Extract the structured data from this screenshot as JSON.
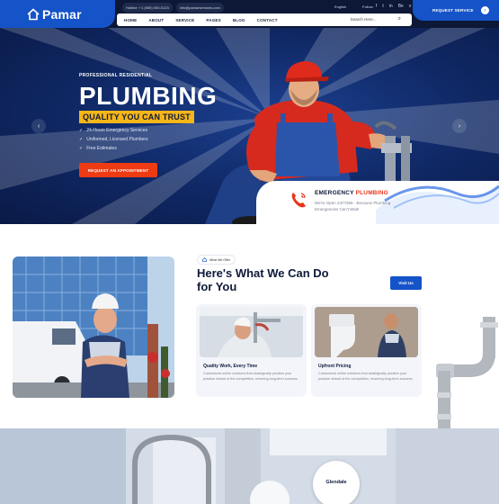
{
  "brand": {
    "name": "Pamar",
    "color": "#1553c8",
    "accent": "#ee3b14",
    "highlight": "#f5b618"
  },
  "topbar": {
    "contacts": [
      "Hotline: +1 (555) 000-0123",
      "info@pamarservices.com"
    ],
    "language": "English",
    "follow_label": "Follow:",
    "socials": [
      "f",
      "t",
      "in",
      "Be",
      "x"
    ],
    "request_label": "REQUEST SERVICE",
    "request_icon": "arrow-right-icon"
  },
  "nav": {
    "items": [
      "HOME",
      "ABOUT",
      "SERVICE",
      "PAGES",
      "BLOG",
      "CONTACT"
    ],
    "search_placeholder": "Search Here..."
  },
  "hero": {
    "eyebrow": "PROFESSIONAL RESIDENTIAL",
    "title": "PLUMBING",
    "tagline": "QUALITY YOU CAN TRUST",
    "bullets": [
      "24-Hours Emergency Services",
      "Uniformed, Licensed Plumbers",
      "Free Estimates"
    ],
    "cta": "REQUEST AN APPOINTMENT",
    "prev_icon": "chevron-left-icon",
    "next_icon": "chevron-right-icon",
    "emergency": {
      "title_prefix": "EMERGENCY",
      "title_highlight": "PLUMBING",
      "text": "We're Open 24/7/365 - Because Plumbing Emergencies Can't Wait!"
    }
  },
  "services": {
    "badge": "What We Offer",
    "heading": "Here's What We Can Do for You",
    "visit_label": "Visit Us",
    "cards": [
      {
        "title": "Quality Work, Every Time",
        "text": "Customized online solutions that strategically position your practice ahead of the competition, ensuring long-term success."
      },
      {
        "title": "Upfront Pricing",
        "text": "Customized online solutions that strategically position your practice ahead of the competition, ensuring long-term success."
      }
    ]
  },
  "bottom": {
    "location": "Glendale"
  }
}
